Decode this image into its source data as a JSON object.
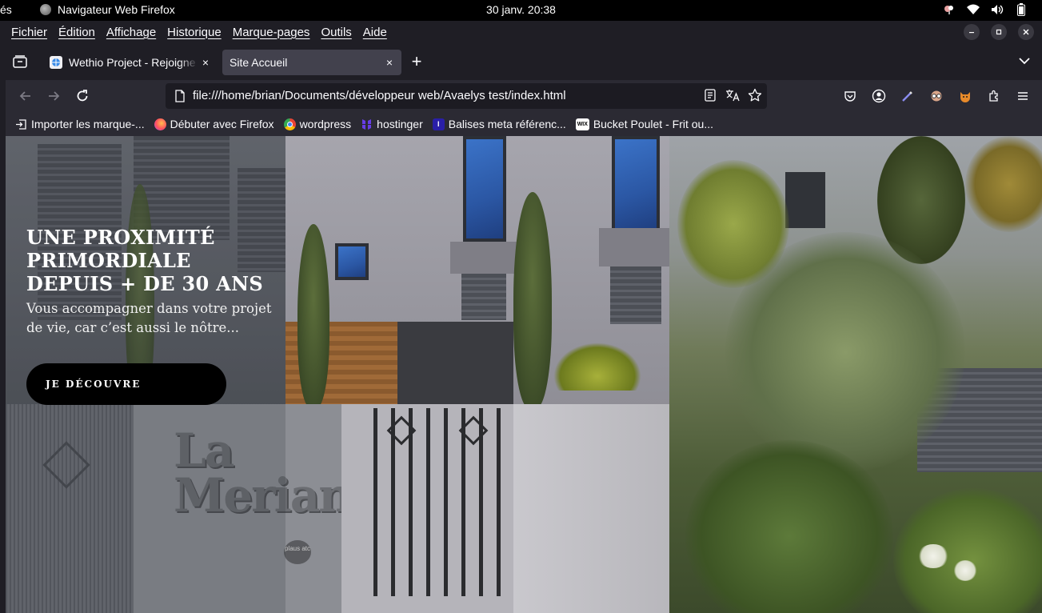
{
  "system": {
    "activities_label": "és",
    "app_name": "Navigateur Web Firefox",
    "clock": "30 janv.  20:38"
  },
  "menu": {
    "items": [
      "Fichier",
      "Édition",
      "Affichage",
      "Historique",
      "Marque-pages",
      "Outils",
      "Aide"
    ]
  },
  "tabs": [
    {
      "title": "Wethio Project - Rejoigne",
      "close": "×"
    },
    {
      "title": "Site Accueil",
      "close": "×"
    }
  ],
  "new_tab_label": "+",
  "urlbar": {
    "url": "file:///home/brian/Documents/développeur web/Avaelys test/index.html"
  },
  "bookmarks": [
    {
      "label": "Importer les marque-...",
      "icon": "import-icon"
    },
    {
      "label": "Débuter avec Firefox",
      "icon": "firefox-icon"
    },
    {
      "label": "wordpress",
      "icon": "chrome-icon"
    },
    {
      "label": "hostinger",
      "icon": "hostinger-icon"
    },
    {
      "label": "Balises meta référenc...",
      "icon": "page-icon"
    },
    {
      "label": "Bucket Poulet - Frit ou...",
      "icon": "wix-icon",
      "badge": "WIX"
    }
  ],
  "hero": {
    "title": "UNE PROXIMITÉ PRIMORDIALE DEPUIS + DE 30 ANS",
    "subtitle": "Vous accompagner dans votre projet de vie, car c’est aussi le nôtre...",
    "cta_label": "JE DÉCOUVRE"
  },
  "sign": {
    "line1": "La",
    "line2": "Meriane",
    "plaque": "plaus atc"
  },
  "colors": {
    "chrome_bg": "#1f1e25",
    "toolbar_bg": "#2b2a33",
    "active_tab": "#42414d",
    "cta_bg": "#000000"
  }
}
